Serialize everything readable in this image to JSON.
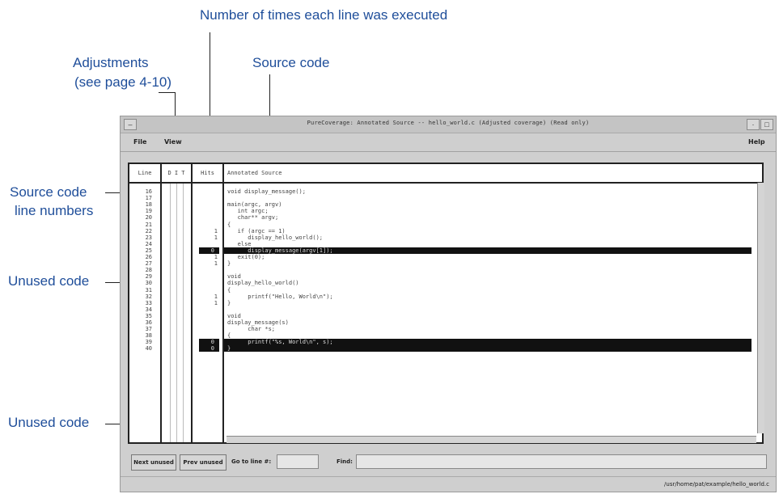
{
  "callouts": {
    "executed": "Number of times each line was executed",
    "adjust_line1": "Adjustments",
    "adjust_line2": "(see page 4-10)",
    "source_code": "Source code",
    "line_numbers_line1": "Source code",
    "line_numbers_line2": "line numbers",
    "unused1": "Unused code",
    "unused2": "Unused code"
  },
  "window": {
    "title": "PureCoverage: Annotated Source -- hello_world.c (Adjusted coverage) (Read only)",
    "menus": [
      "File",
      "View"
    ],
    "help": "Help"
  },
  "columns": {
    "line": "Line",
    "adjust": "D I T",
    "hits": "Hits",
    "source": "Annotated Source"
  },
  "rows": [
    {
      "n": "16",
      "hits": "",
      "src": "void display_message();",
      "hl": false
    },
    {
      "n": "17",
      "hits": "",
      "src": "",
      "hl": false
    },
    {
      "n": "18",
      "hits": "",
      "src": "main(argc, argv)",
      "hl": false
    },
    {
      "n": "19",
      "hits": "",
      "src": "   int argc;",
      "hl": false
    },
    {
      "n": "20",
      "hits": "",
      "src": "   char** argv;",
      "hl": false
    },
    {
      "n": "21",
      "hits": "",
      "src": "{",
      "hl": false
    },
    {
      "n": "22",
      "hits": "1",
      "src": "   if (argc == 1)",
      "hl": false
    },
    {
      "n": "23",
      "hits": "1",
      "src": "      display_hello_world();",
      "hl": false
    },
    {
      "n": "24",
      "hits": "",
      "src": "   else",
      "hl": false
    },
    {
      "n": "25",
      "hits": "0",
      "src": "      display_message(argv[1]);",
      "hl": true
    },
    {
      "n": "26",
      "hits": "1",
      "src": "   exit(0);",
      "hl": false
    },
    {
      "n": "27",
      "hits": "1",
      "src": "}",
      "hl": false
    },
    {
      "n": "28",
      "hits": "",
      "src": "",
      "hl": false
    },
    {
      "n": "29",
      "hits": "",
      "src": "void",
      "hl": false
    },
    {
      "n": "30",
      "hits": "",
      "src": "display_hello_world()",
      "hl": false
    },
    {
      "n": "31",
      "hits": "",
      "src": "{",
      "hl": false
    },
    {
      "n": "32",
      "hits": "1",
      "src": "      printf(\"Hello, World\\n\");",
      "hl": false
    },
    {
      "n": "33",
      "hits": "1",
      "src": "}",
      "hl": false
    },
    {
      "n": "34",
      "hits": "",
      "src": "",
      "hl": false
    },
    {
      "n": "35",
      "hits": "",
      "src": "void",
      "hl": false
    },
    {
      "n": "36",
      "hits": "",
      "src": "display_message(s)",
      "hl": false
    },
    {
      "n": "37",
      "hits": "",
      "src": "      char *s;",
      "hl": false
    },
    {
      "n": "38",
      "hits": "",
      "src": "{",
      "hl": false
    },
    {
      "n": "39",
      "hits": "0",
      "src": "      printf(\"%s, World\\n\", s);",
      "hl": true
    },
    {
      "n": "40",
      "hits": "0",
      "src": "}",
      "hl": true
    }
  ],
  "bottom": {
    "next_unused": "Next unused",
    "prev_unused": "Prev unused",
    "goto_label": "Go to line #:",
    "goto_value": "",
    "find_label": "Find:",
    "find_value": ""
  },
  "status_path": "/usr/home/pat/example/hello_world.c",
  "colors": {
    "callout": "#1f4e9a",
    "highlight": "#111111"
  }
}
